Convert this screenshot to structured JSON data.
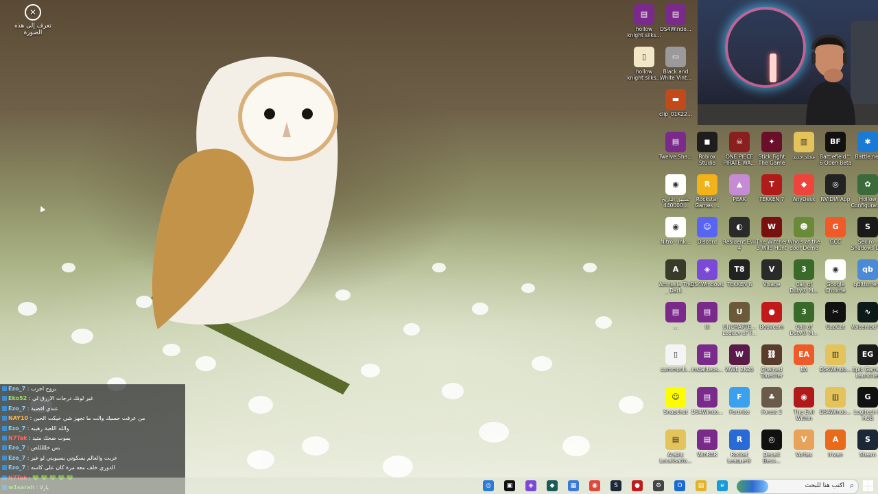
{
  "top_left_icon": {
    "icon": "circle-x-icon",
    "label": "تعرف إلى هذه الصورة"
  },
  "desktop_icons": [
    {
      "label": "hollow knight silks...",
      "icon": "winrar-icon",
      "color": "#7a2a8a",
      "glyph": "▤"
    },
    {
      "label": "DS4Windo...",
      "icon": "winrar-icon",
      "color": "#7a2a8a",
      "glyph": "▤"
    },
    {
      "label": "hollow knight silks...",
      "icon": "file-icon",
      "color": "#f2e7c6",
      "glyph": "▯"
    },
    {
      "label": "Black and White Vint...",
      "icon": "image-file-icon",
      "color": "#9a9a9a",
      "glyph": "▭"
    },
    {
      "label": "clip_01K22...",
      "icon": "video-file-icon",
      "color": "#c24a1a",
      "glyph": "▬"
    },
    {
      "label": "Twelve.Sha...",
      "icon": "winrar-icon",
      "color": "#7a2a8a",
      "glyph": "▤"
    },
    {
      "label": "Roblox Studio",
      "icon": "roblox-studio-icon",
      "color": "#1d1d1d",
      "glyph": "◼"
    },
    {
      "label": "ONE PIECE PIRATE WA...",
      "icon": "onepiece-icon",
      "color": "#8a1f1f",
      "glyph": "☠"
    },
    {
      "label": "Stick Fight The Game",
      "icon": "stickfight-icon",
      "color": "#6a0f2a",
      "glyph": "✦"
    },
    {
      "label": "مجلد جديد",
      "icon": "folder-zip-icon",
      "color": "#e3c35a",
      "glyph": "▥"
    },
    {
      "label": "Battlefield™ 6 Open Beta",
      "icon": "battlefield-icon",
      "color": "#111111",
      "glyph": "BF"
    },
    {
      "label": "Battle.net",
      "icon": "battlenet-icon",
      "color": "#1a7ad6",
      "glyph": "✱"
    },
    {
      "label": "تطبيق التاريخ 440000...",
      "icon": "chrome-icon",
      "color": "#ffffff",
      "glyph": "◉"
    },
    {
      "label": "Rockstar Games ...",
      "icon": "rockstar-icon",
      "color": "#f2b21a",
      "glyph": "R"
    },
    {
      "label": "PEAK",
      "icon": "peak-icon",
      "color": "#c58bd4",
      "glyph": "▲"
    },
    {
      "label": "TEKKEN 7",
      "icon": "tekken7-icon",
      "color": "#b11a1a",
      "glyph": "T"
    },
    {
      "label": "AnyDesk",
      "icon": "anydesk-icon",
      "color": "#ef443b",
      "glyph": "◆"
    },
    {
      "label": "NVIDIA App",
      "icon": "nvidia-icon",
      "color": "#222222",
      "glyph": "◎"
    },
    {
      "label": "Hollow Configurati...",
      "icon": "hollow-config-icon",
      "color": "#3b6a3b",
      "glyph": "✿"
    },
    {
      "label": "Nitro - Ink...",
      "icon": "chrome-icon",
      "color": "#ffffff",
      "glyph": "◉"
    },
    {
      "label": "Discord",
      "icon": "discord-icon",
      "color": "#5865f2",
      "glyph": "☺"
    },
    {
      "label": "Resident Evil 4",
      "icon": "re4-icon",
      "color": "#2a2a2a",
      "glyph": "◐"
    },
    {
      "label": "The Witcher 3 Wild Hunt",
      "icon": "witcher-icon",
      "color": "#7a0f0f",
      "glyph": "W"
    },
    {
      "label": "Who's at the door Demo",
      "icon": "whos-door-icon",
      "color": "#6a8a3a",
      "glyph": "☻"
    },
    {
      "label": "GCC",
      "icon": "gcc-icon",
      "color": "#f05a28",
      "glyph": "G"
    },
    {
      "label": "Sekiro - Shadows D...",
      "icon": "sekiro-icon",
      "color": "#1a1a1a",
      "glyph": "S"
    },
    {
      "label": "Amnesia The Dark Descent",
      "icon": "amnesia-icon",
      "color": "#3a3a2a",
      "glyph": "A"
    },
    {
      "label": "DS4Windows",
      "icon": "ds4windows-icon",
      "color": "#7a4ad6",
      "glyph": "◈"
    },
    {
      "label": "TEKKEN 8",
      "icon": "tekken8-icon",
      "color": "#222222",
      "glyph": "T8"
    },
    {
      "label": "Visage",
      "icon": "visage-icon",
      "color": "#2a2a2a",
      "glyph": "V"
    },
    {
      "label": "Call of Duty® M...",
      "icon": "cod-icon",
      "color": "#3a6a2a",
      "glyph": "3"
    },
    {
      "label": "Google Chrome",
      "icon": "chrome-icon",
      "color": "#ffffff",
      "glyph": "◉"
    },
    {
      "label": "qBittorrent",
      "icon": "qbittorrent-icon",
      "color": "#4a8ad6",
      "glyph": "qb"
    },
    {
      "label": "...",
      "icon": "winrar-icon",
      "color": "#7a2a8a",
      "glyph": "▤"
    },
    {
      "label": "Ili",
      "icon": "winrar-icon",
      "color": "#7a2a8a",
      "glyph": "▤"
    },
    {
      "label": "UNCHARTE... Legacy of T...",
      "icon": "uncharted-icon",
      "color": "#6a5a3a",
      "glyph": "U"
    },
    {
      "label": "Bodycam",
      "icon": "bodycam-icon",
      "color": "#c21a1a",
      "glyph": "●"
    },
    {
      "label": "Call of Duty® M...",
      "icon": "cod-icon",
      "color": "#3a6a2a",
      "glyph": "3"
    },
    {
      "label": "CapCut",
      "icon": "capcut-icon",
      "color": "#111111",
      "glyph": "✂"
    },
    {
      "label": "Voicemod V3",
      "icon": "voicemod-icon",
      "color": "#0d1a1a",
      "glyph": "∿"
    },
    {
      "label": "commonli...",
      "icon": "text-file-icon",
      "color": "#f4f4f4",
      "glyph": "▯"
    },
    {
      "label": "Instaliteos...",
      "icon": "winrar-icon",
      "color": "#7a2a8a",
      "glyph": "▤"
    },
    {
      "label": "WWE 2K25",
      "icon": "wwe-icon",
      "color": "#5a1a4a",
      "glyph": "W"
    },
    {
      "label": "Chained Together",
      "icon": "chained-icon",
      "color": "#5a3a2a",
      "glyph": "⛓"
    },
    {
      "label": "EA",
      "icon": "ea-icon",
      "color": "#f05a28",
      "glyph": "EA"
    },
    {
      "label": "DS4Windo...",
      "icon": "folder-zip-icon",
      "color": "#e3c35a",
      "glyph": "▥"
    },
    {
      "label": "Epic Games Launcher",
      "icon": "epic-games-icon",
      "color": "#1a1a1a",
      "glyph": "EG"
    },
    {
      "label": "Snapchat",
      "icon": "snapchat-icon",
      "color": "#fffc00",
      "glyph": "☺"
    },
    {
      "label": "DS4Windo...",
      "icon": "winrar-icon",
      "color": "#7a2a8a",
      "glyph": "▤"
    },
    {
      "label": "Fortnite",
      "icon": "fortnite-icon",
      "color": "#3aa0f0",
      "glyph": "F"
    },
    {
      "label": "Forest 2",
      "icon": "forest-icon",
      "color": "#6a5a4a",
      "glyph": "♣"
    },
    {
      "label": "The Evil Within",
      "icon": "evil-within-icon",
      "color": "#b01a1a",
      "glyph": "◉"
    },
    {
      "label": "DS4Windo...",
      "icon": "folder-zip-icon",
      "color": "#e3c35a",
      "glyph": "▥"
    },
    {
      "label": "Logitech G HUB",
      "icon": "logitech-icon",
      "color": "#111111",
      "glyph": "G"
    },
    {
      "label": "Arabic Localisatio...",
      "icon": "folder-icon",
      "color": "#e3c35a",
      "glyph": "▤"
    },
    {
      "label": "WinRAR",
      "icon": "winrar-icon",
      "color": "#7a2a8a",
      "glyph": "▤"
    },
    {
      "label": "Rocket League®",
      "icon": "rocket-league-icon",
      "color": "#2a6ad6",
      "glyph": "R"
    },
    {
      "label": "Deceit Beco...",
      "icon": "deceit-icon",
      "color": "#111111",
      "glyph": "◎"
    },
    {
      "label": "Vortex",
      "icon": "vortex-icon",
      "color": "#e8a25a",
      "glyph": "V"
    },
    {
      "label": "Iriven",
      "icon": "iriven-icon",
      "color": "#e86a1a",
      "glyph": "A"
    },
    {
      "label": "Steam",
      "icon": "steam-icon",
      "color": "#1b2838",
      "glyph": "S"
    },
    {
      "label": "Arabic Localisatio...",
      "icon": "winrar-icon",
      "color": "#7a2a8a",
      "glyph": "▤"
    }
  ],
  "chat": [
    {
      "user": "Ezo_7",
      "text": "بروح اجرب",
      "color": "c1"
    },
    {
      "user": "Eko52",
      "text": "غير لونك درجات الازرق لي",
      "color": "c2"
    },
    {
      "user": "Ezo_7",
      "text": "عندي اقضية",
      "color": "c1"
    },
    {
      "user": "NAY10",
      "text": "من عرفت حسبك والت ما تجهز شي خيكت الحين",
      "color": "c3"
    },
    {
      "user": "Ezo_7",
      "text": "والله اللعبة رهيبه",
      "color": "c1"
    },
    {
      "user": "N7Tak",
      "text": "يموت ضحك متيد",
      "color": "c4"
    },
    {
      "user": "Ezo_7",
      "text": "بس خلللللص",
      "color": "c1"
    },
    {
      "user": "Ezo_7",
      "text": "غربت والعالم يسكوتي يسيويني لو غير",
      "color": "c1"
    },
    {
      "user": "Ezo_7",
      "text": "الدوري خلف معه مرة كان على كاسه",
      "color": "c1"
    },
    {
      "user": "N7Tak",
      "text": "💚 💚 💚 💚 💚",
      "color": "c4"
    },
    {
      "user": "w1sarah",
      "text": "يازلا",
      "color": "c2"
    }
  ],
  "taskbar": {
    "apps": [
      {
        "icon": "browser-icon",
        "color": "#2a7ad6",
        "glyph": "◎"
      },
      {
        "icon": "terminal-icon",
        "color": "#111111",
        "glyph": "▣"
      },
      {
        "icon": "ds4windows-icon",
        "color": "#7a4ad6",
        "glyph": "◈"
      },
      {
        "icon": "app-icon",
        "color": "#1a5a5a",
        "glyph": "◆"
      },
      {
        "icon": "store-icon",
        "color": "#3a7ad6",
        "glyph": "▦"
      },
      {
        "icon": "chrome-icon",
        "color": "#e0463a",
        "glyph": "◉"
      },
      {
        "icon": "steam-icon",
        "color": "#1b2838",
        "glyph": "S"
      },
      {
        "icon": "app-red-icon",
        "color": "#c21a1a",
        "glyph": "●"
      },
      {
        "icon": "settings-icon",
        "color": "#444444",
        "glyph": "⚙"
      },
      {
        "icon": "outlook-icon",
        "color": "#1a6ad6",
        "glyph": "O"
      },
      {
        "icon": "file-explorer-icon",
        "color": "#e3b22a",
        "glyph": "▤"
      },
      {
        "icon": "edge-icon",
        "color": "#1a9ad6",
        "glyph": "e"
      }
    ],
    "search_placeholder": "اكتب هنا للبحث"
  }
}
